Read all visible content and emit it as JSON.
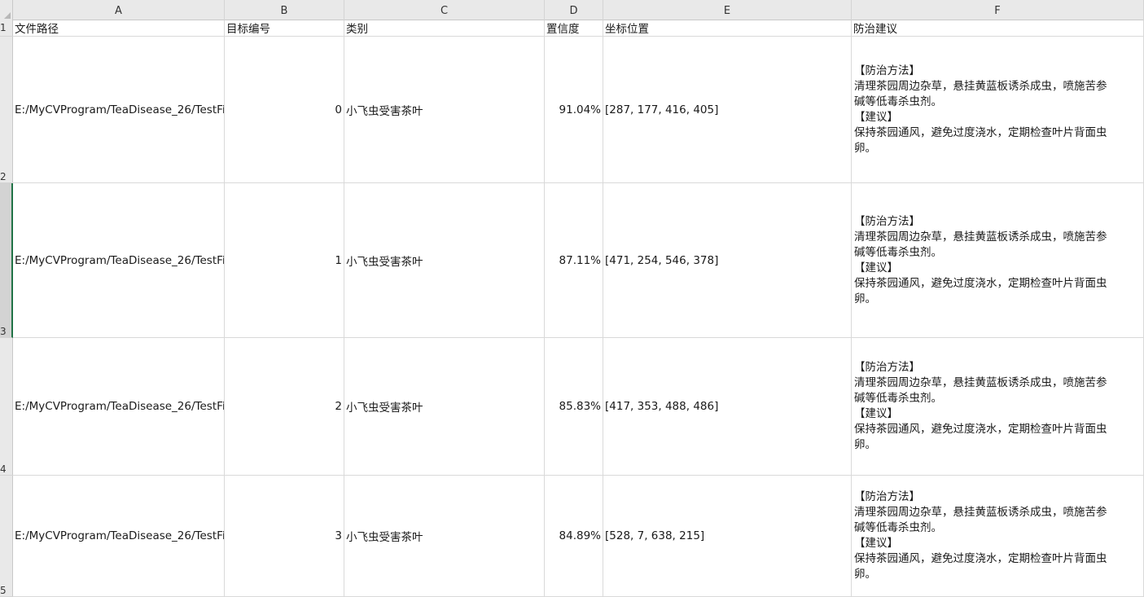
{
  "columns": [
    {
      "letter": "A"
    },
    {
      "letter": "B"
    },
    {
      "letter": "C"
    },
    {
      "letter": "D"
    },
    {
      "letter": "E"
    },
    {
      "letter": "F"
    }
  ],
  "row_numbers": [
    "1",
    "2",
    "3",
    "4",
    "5"
  ],
  "selected_row": "3",
  "headers": {
    "file_path": "文件路径",
    "target_id": "目标编号",
    "category": "类别",
    "confidence": "置信度",
    "coordinates": "坐标位置",
    "advice": "防治建议"
  },
  "rows": [
    {
      "file_path": "E:/MyCVProgram/TeaDisease_26/TestFi",
      "target_id": "0",
      "category": "小飞虫受害茶叶",
      "confidence": "91.04%",
      "coordinates": "[287, 177, 416, 405]",
      "advice": {
        "method_title": "【防治方法】",
        "method_line1": "清理茶园周边杂草，悬挂黄蓝板诱杀成虫，喷施苦参",
        "method_line2": "碱等低毒杀虫剂。",
        "suggest_title": "【建议】",
        "suggest_line1": "保持茶园通风，避免过度浇水，定期检查叶片背面虫",
        "suggest_line2": "卵。"
      }
    },
    {
      "file_path": "E:/MyCVProgram/TeaDisease_26/TestFi",
      "target_id": "1",
      "category": "小飞虫受害茶叶",
      "confidence": "87.11%",
      "coordinates": "[471, 254, 546, 378]",
      "advice": {
        "method_title": "【防治方法】",
        "method_line1": "清理茶园周边杂草，悬挂黄蓝板诱杀成虫，喷施苦参",
        "method_line2": "碱等低毒杀虫剂。",
        "suggest_title": "【建议】",
        "suggest_line1": "保持茶园通风，避免过度浇水，定期检查叶片背面虫",
        "suggest_line2": "卵。"
      }
    },
    {
      "file_path": "E:/MyCVProgram/TeaDisease_26/TestFi",
      "target_id": "2",
      "category": "小飞虫受害茶叶",
      "confidence": "85.83%",
      "coordinates": "[417, 353, 488, 486]",
      "advice": {
        "method_title": "【防治方法】",
        "method_line1": "清理茶园周边杂草，悬挂黄蓝板诱杀成虫，喷施苦参",
        "method_line2": "碱等低毒杀虫剂。",
        "suggest_title": "【建议】",
        "suggest_line1": "保持茶园通风，避免过度浇水，定期检查叶片背面虫",
        "suggest_line2": "卵。"
      }
    },
    {
      "file_path": "E:/MyCVProgram/TeaDisease_26/TestFi",
      "target_id": "3",
      "category": "小飞虫受害茶叶",
      "confidence": "84.89%",
      "coordinates": "[528, 7, 638, 215]",
      "advice": {
        "method_title": "【防治方法】",
        "method_line1": "清理茶园周边杂草，悬挂黄蓝板诱杀成虫，喷施苦参",
        "method_line2": "碱等低毒杀虫剂。",
        "suggest_title": "【建议】",
        "suggest_line1": "保持茶园通风，避免过度浇水，定期检查叶片背面虫",
        "suggest_line2": "卵。"
      }
    }
  ],
  "colors": {
    "header_bg": "#e9e9e9",
    "gridline": "#d9d9d9",
    "selection_accent": "#217346"
  }
}
